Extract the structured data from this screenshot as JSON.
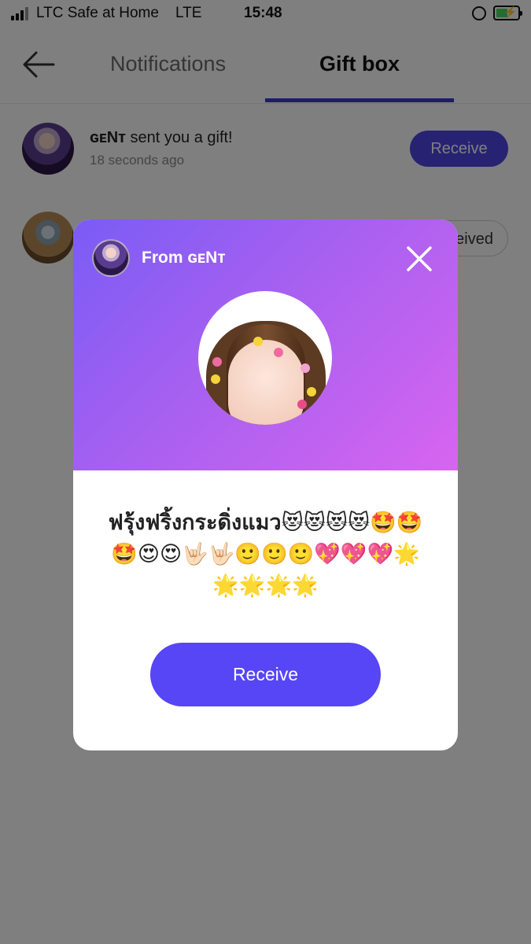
{
  "status_bar": {
    "carrier": "LTC Safe at Home",
    "network": "LTE",
    "time": "15:48"
  },
  "header": {
    "back_icon": "arrow-left-icon",
    "tabs": [
      {
        "label": "Notifications",
        "active": false
      },
      {
        "label": "Gift box",
        "active": true
      }
    ]
  },
  "list": {
    "items": [
      {
        "sender": "ɢᴇNᴛ",
        "message": "sent you a gift!",
        "time": "18 seconds ago",
        "action": "Receive"
      },
      {
        "action": "Received"
      }
    ]
  },
  "modal": {
    "from_prefix": "From",
    "from_name": "ɢᴇNᴛ",
    "close_icon": "close-icon",
    "message": "ฟรุ้งฟริ้งกระดิ่งแมว😻😻😻😻🤩🤩🤩😍😍🤟🏻🤟🏻🙂🙂🙂💖💖💖🌟🌟🌟🌟🌟",
    "receive_label": "Receive"
  },
  "colors": {
    "accent": "#4f46e5",
    "receive_big": "#5646f5",
    "tab_underline": "#3f38c6",
    "modal_gradient_start": "#7a5cf5",
    "modal_gradient_end": "#d765f0"
  }
}
